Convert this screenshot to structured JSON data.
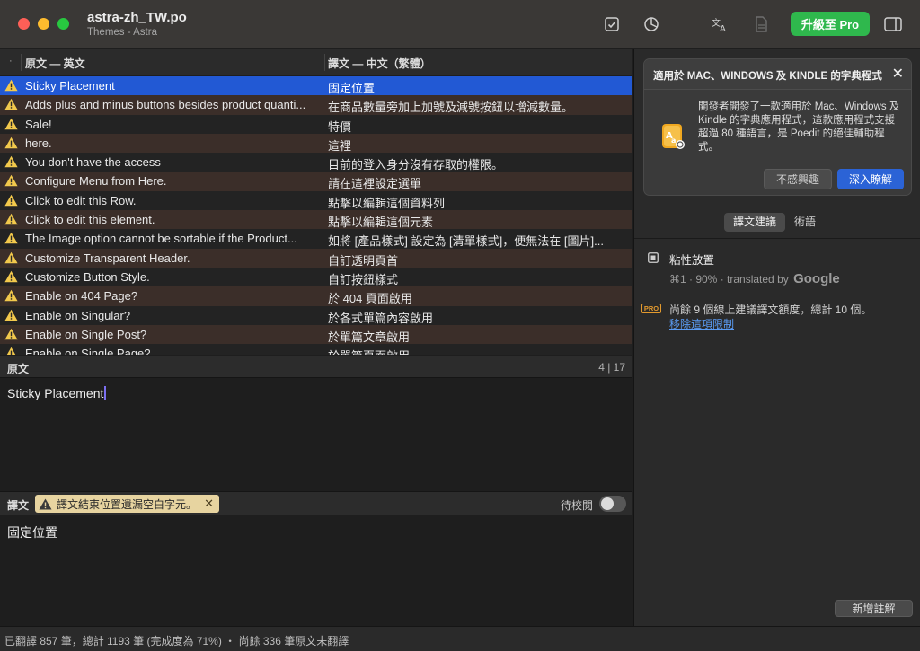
{
  "window": {
    "title": "astra-zh_TW.po",
    "subtitle": "Themes - Astra",
    "upgrade_label": "升級至 Pro"
  },
  "icons": {
    "validate": "checkbox-icon",
    "stats": "pie-chart-icon",
    "translate": "translate-icon",
    "document": "document-icon",
    "sidebar": "sidebar-toggle-icon",
    "warning": "warning-triangle-icon"
  },
  "list": {
    "header_dot": "·",
    "source_header": "原文 — 英文",
    "target_header": "譯文 — 中文（繁體）",
    "rows": [
      {
        "source": "Sticky Placement",
        "target": "固定位置"
      },
      {
        "source": "Adds plus and minus buttons besides product quanti...",
        "target": "在商品數量旁加上加號及減號按鈕以增減數量。"
      },
      {
        "source": "Sale!",
        "target": "特價"
      },
      {
        "source": "here.",
        "target": "這裡"
      },
      {
        "source": "You don't have the access",
        "target": "目前的登入身分沒有存取的權限。"
      },
      {
        "source": "Configure Menu from Here.",
        "target": "請在這裡設定選單"
      },
      {
        "source": "Click to edit this Row.",
        "target": "點擊以編輯這個資料列"
      },
      {
        "source": "Click to edit this element.",
        "target": "點擊以編輯這個元素"
      },
      {
        "source": "The Image option cannot be sortable if the Product...",
        "target": "如將 [產品樣式] 設定為 [清單樣式]，便無法在 [圖片]..."
      },
      {
        "source": "Customize Transparent Header.",
        "target": "自訂透明頁首"
      },
      {
        "source": "Customize Button Style.",
        "target": "自訂按鈕樣式"
      },
      {
        "source": "Enable on 404 Page?",
        "target": "於 404 頁面啟用"
      },
      {
        "source": "Enable on Singular?",
        "target": "於各式單篇內容啟用"
      },
      {
        "source": "Enable on Single Post?",
        "target": "於單篇文章啟用"
      },
      {
        "source": "Enable on Single Page?",
        "target": "於單篇頁面啟用"
      }
    ]
  },
  "source_panel": {
    "label": "原文",
    "counter": "4 | 17",
    "text": "Sticky Placement"
  },
  "translation_panel": {
    "label": "譯文",
    "warning": "譯文結束位置遺漏空白字元。",
    "warning_close": "✕",
    "fuzzy_label": "待校閱",
    "fuzzy_on": false,
    "text": "固定位置"
  },
  "status_bar": {
    "text": "已翻譯 857 筆，總計 1193 筆 (完成度為 71%) ・ 尚餘 336 筆原文未翻譯"
  },
  "promo_card": {
    "title": "適用於 MAC、WINDOWS 及 KINDLE 的字典程式",
    "close": "✕",
    "body": "開發者開發了一款適用於 Mac、Windows 及 Kindle 的字典應用程式，這款應用程式支援超過 80 種語言，是 Poedit 的絕佳輔助程式。",
    "dismiss_label": "不感興趣",
    "learn_label": "深入瞭解"
  },
  "sidebar": {
    "tabs": [
      {
        "label": "譯文建議",
        "active": true
      },
      {
        "label": "術語",
        "active": false
      }
    ],
    "suggestion": {
      "text": "粘性放置",
      "shortcut": "⌘1 · 90% ·",
      "provider_prefix": "translated by",
      "provider": "Google"
    },
    "pro_badge": "PRO",
    "limit_text": "尚餘 9 個線上建議譯文額度，總計 10 個。",
    "limit_link": "移除這項限制",
    "add_note_label": "新增註解"
  },
  "colors": {
    "selection": "#2259d4",
    "upgrade_green": "#2fb84d",
    "warning_yellow": "#f2c94c",
    "link_blue": "#5a9bf3"
  }
}
